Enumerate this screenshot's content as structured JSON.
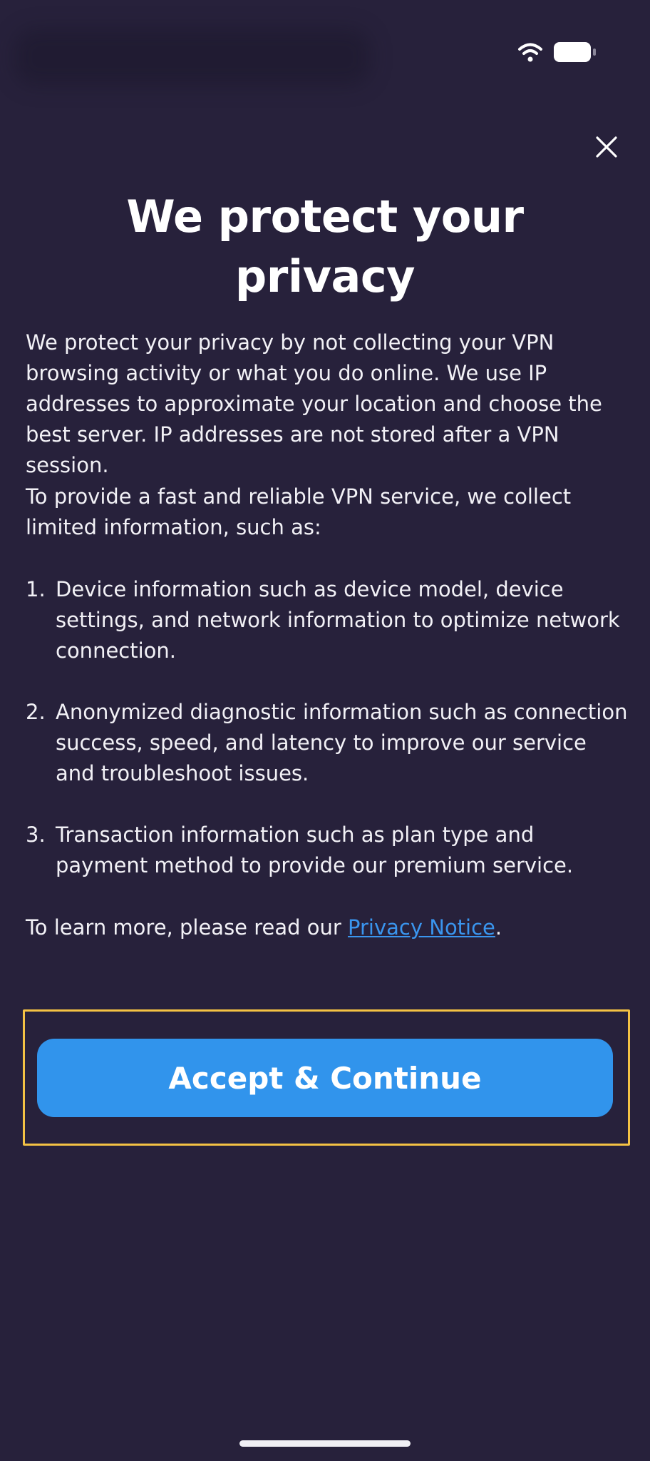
{
  "status_bar": {
    "wifi_icon": "wifi-icon",
    "battery_icon": "battery-icon"
  },
  "close_icon": "close-icon",
  "title_line1": "We protect your",
  "title_line2": "privacy",
  "paragraph1": "We protect your privacy by not collecting your VPN browsing activity or what you do online. We use IP addresses to approximate your location and choose the best server. IP addresses are not stored after a VPN session.",
  "paragraph2": "To provide a fast and reliable VPN service, we collect limited information, such as:",
  "list": [
    {
      "num": "1.",
      "text": "Device information such as device model, device settings, and network information to optimize network connection."
    },
    {
      "num": "2.",
      "text": "Anonymized diagnostic information such as connection success, speed, and latency to improve our service and troubleshoot issues."
    },
    {
      "num": "3.",
      "text": "Transaction information such as plan type and payment method to provide our premium service."
    }
  ],
  "learn_more": {
    "prefix": "To learn more, please read our ",
    "link_label": "Privacy Notice",
    "suffix": "."
  },
  "accept_button_label": "Accept & Continue",
  "colors": {
    "background": "#27213b",
    "accent": "#3194ec",
    "link": "#3a95ee",
    "highlight": "#f4c244"
  }
}
